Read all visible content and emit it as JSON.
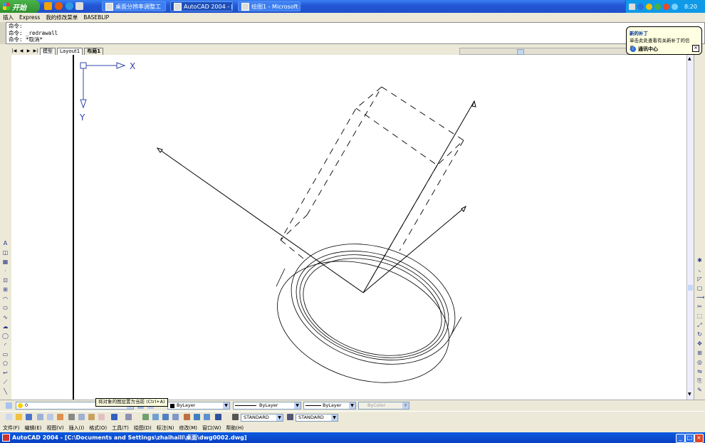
{
  "taskbar": {
    "start_label": "开始",
    "tasks": [
      {
        "label": "桌面分辨率调整工"
      },
      {
        "label": "AutoCAD 2004 - [:"
      },
      {
        "label": "绘图1 - Microsoft"
      }
    ],
    "clock": "8:20"
  },
  "menubar": {
    "items": [
      "插入",
      "Express",
      "我的修改菜单",
      "BASEBLIP"
    ]
  },
  "command_window": {
    "lines": [
      "命令:",
      "命令: _redrawall",
      "命令: *取消*"
    ]
  },
  "balloon": {
    "title": "新的补丁",
    "message": "单击此处查看有关新补丁的信息。",
    "footer": "通讯中心"
  },
  "layout_tabs": [
    "模型",
    "Layout1",
    "布局1"
  ],
  "ucs": {
    "x_label": "X",
    "y_label": "Y"
  },
  "toolbar_properties": {
    "layer_value": "0",
    "color_value": "ByLayer",
    "linetype_value": "ByLayer",
    "lineweight_value": "ByLayer",
    "plotstyle_value": "ByColor"
  },
  "toolbar_styles": {
    "text_style": "STANDARD",
    "dim_style": "STANDARD"
  },
  "tooltip": "将对象的图层置为当前 (Ctrl+A)",
  "bottom_menu": {
    "items": [
      "文件(F)",
      "编辑(E)",
      "视图(V)",
      "插入(I)",
      "格式(O)",
      "工具(T)",
      "绘图(D)",
      "标注(N)",
      "修改(M)",
      "窗口(W)",
      "帮助(H)"
    ]
  },
  "window_title": "AutoCAD 2004 - [C:\\Documents and Settings\\zhaihaili\\桌面\\dwg0002.dwg]",
  "colors": {
    "taskbar_blue": "#2457d6",
    "titlebar_blue": "#0a4fd8",
    "balloon_bg": "#ffffe1",
    "start_green": "#3aa33a"
  },
  "icons": {
    "left_toolbar": [
      "line-icon",
      "construction-line-icon",
      "polyline-icon",
      "polygon-icon",
      "rectangle-icon",
      "arc-icon",
      "circle-icon",
      "revision-cloud-icon",
      "spline-icon",
      "ellipse-icon",
      "ellipse-arc-icon",
      "insert-block-icon",
      "make-block-icon",
      "point-icon",
      "hatch-icon",
      "region-icon",
      "multiline-text-icon"
    ],
    "right_toolbar": [
      "erase-icon",
      "copy-icon",
      "mirror-icon",
      "offset-icon",
      "array-icon",
      "move-icon",
      "rotate-icon",
      "scale-icon",
      "stretch-icon",
      "trim-icon",
      "extend-icon",
      "break-icon",
      "chamfer-icon",
      "fillet-icon",
      "explode-icon"
    ]
  }
}
